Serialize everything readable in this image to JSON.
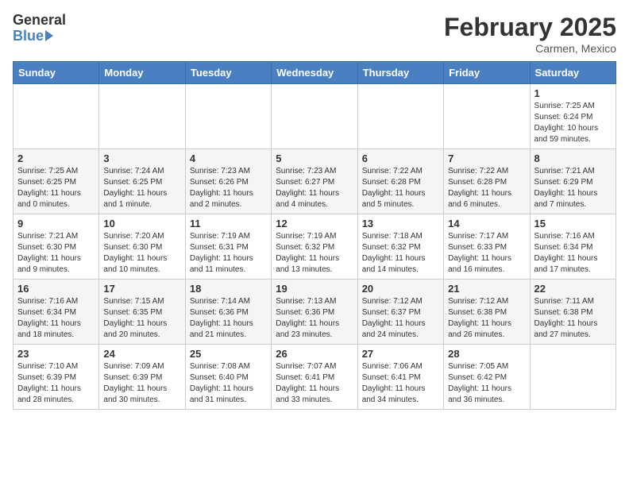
{
  "header": {
    "logo_general": "General",
    "logo_blue": "Blue",
    "month_title": "February 2025",
    "location": "Carmen, Mexico"
  },
  "weekdays": [
    "Sunday",
    "Monday",
    "Tuesday",
    "Wednesday",
    "Thursday",
    "Friday",
    "Saturday"
  ],
  "weeks": [
    [
      {
        "day": "",
        "info": ""
      },
      {
        "day": "",
        "info": ""
      },
      {
        "day": "",
        "info": ""
      },
      {
        "day": "",
        "info": ""
      },
      {
        "day": "",
        "info": ""
      },
      {
        "day": "",
        "info": ""
      },
      {
        "day": "1",
        "info": "Sunrise: 7:25 AM\nSunset: 6:24 PM\nDaylight: 10 hours\nand 59 minutes."
      }
    ],
    [
      {
        "day": "2",
        "info": "Sunrise: 7:25 AM\nSunset: 6:25 PM\nDaylight: 11 hours\nand 0 minutes."
      },
      {
        "day": "3",
        "info": "Sunrise: 7:24 AM\nSunset: 6:25 PM\nDaylight: 11 hours\nand 1 minute."
      },
      {
        "day": "4",
        "info": "Sunrise: 7:23 AM\nSunset: 6:26 PM\nDaylight: 11 hours\nand 2 minutes."
      },
      {
        "day": "5",
        "info": "Sunrise: 7:23 AM\nSunset: 6:27 PM\nDaylight: 11 hours\nand 4 minutes."
      },
      {
        "day": "6",
        "info": "Sunrise: 7:22 AM\nSunset: 6:28 PM\nDaylight: 11 hours\nand 5 minutes."
      },
      {
        "day": "7",
        "info": "Sunrise: 7:22 AM\nSunset: 6:28 PM\nDaylight: 11 hours\nand 6 minutes."
      },
      {
        "day": "8",
        "info": "Sunrise: 7:21 AM\nSunset: 6:29 PM\nDaylight: 11 hours\nand 7 minutes."
      }
    ],
    [
      {
        "day": "9",
        "info": "Sunrise: 7:21 AM\nSunset: 6:30 PM\nDaylight: 11 hours\nand 9 minutes."
      },
      {
        "day": "10",
        "info": "Sunrise: 7:20 AM\nSunset: 6:30 PM\nDaylight: 11 hours\nand 10 minutes."
      },
      {
        "day": "11",
        "info": "Sunrise: 7:19 AM\nSunset: 6:31 PM\nDaylight: 11 hours\nand 11 minutes."
      },
      {
        "day": "12",
        "info": "Sunrise: 7:19 AM\nSunset: 6:32 PM\nDaylight: 11 hours\nand 13 minutes."
      },
      {
        "day": "13",
        "info": "Sunrise: 7:18 AM\nSunset: 6:32 PM\nDaylight: 11 hours\nand 14 minutes."
      },
      {
        "day": "14",
        "info": "Sunrise: 7:17 AM\nSunset: 6:33 PM\nDaylight: 11 hours\nand 16 minutes."
      },
      {
        "day": "15",
        "info": "Sunrise: 7:16 AM\nSunset: 6:34 PM\nDaylight: 11 hours\nand 17 minutes."
      }
    ],
    [
      {
        "day": "16",
        "info": "Sunrise: 7:16 AM\nSunset: 6:34 PM\nDaylight: 11 hours\nand 18 minutes."
      },
      {
        "day": "17",
        "info": "Sunrise: 7:15 AM\nSunset: 6:35 PM\nDaylight: 11 hours\nand 20 minutes."
      },
      {
        "day": "18",
        "info": "Sunrise: 7:14 AM\nSunset: 6:36 PM\nDaylight: 11 hours\nand 21 minutes."
      },
      {
        "day": "19",
        "info": "Sunrise: 7:13 AM\nSunset: 6:36 PM\nDaylight: 11 hours\nand 23 minutes."
      },
      {
        "day": "20",
        "info": "Sunrise: 7:12 AM\nSunset: 6:37 PM\nDaylight: 11 hours\nand 24 minutes."
      },
      {
        "day": "21",
        "info": "Sunrise: 7:12 AM\nSunset: 6:38 PM\nDaylight: 11 hours\nand 26 minutes."
      },
      {
        "day": "22",
        "info": "Sunrise: 7:11 AM\nSunset: 6:38 PM\nDaylight: 11 hours\nand 27 minutes."
      }
    ],
    [
      {
        "day": "23",
        "info": "Sunrise: 7:10 AM\nSunset: 6:39 PM\nDaylight: 11 hours\nand 28 minutes."
      },
      {
        "day": "24",
        "info": "Sunrise: 7:09 AM\nSunset: 6:39 PM\nDaylight: 11 hours\nand 30 minutes."
      },
      {
        "day": "25",
        "info": "Sunrise: 7:08 AM\nSunset: 6:40 PM\nDaylight: 11 hours\nand 31 minutes."
      },
      {
        "day": "26",
        "info": "Sunrise: 7:07 AM\nSunset: 6:41 PM\nDaylight: 11 hours\nand 33 minutes."
      },
      {
        "day": "27",
        "info": "Sunrise: 7:06 AM\nSunset: 6:41 PM\nDaylight: 11 hours\nand 34 minutes."
      },
      {
        "day": "28",
        "info": "Sunrise: 7:05 AM\nSunset: 6:42 PM\nDaylight: 11 hours\nand 36 minutes."
      },
      {
        "day": "",
        "info": ""
      }
    ]
  ]
}
